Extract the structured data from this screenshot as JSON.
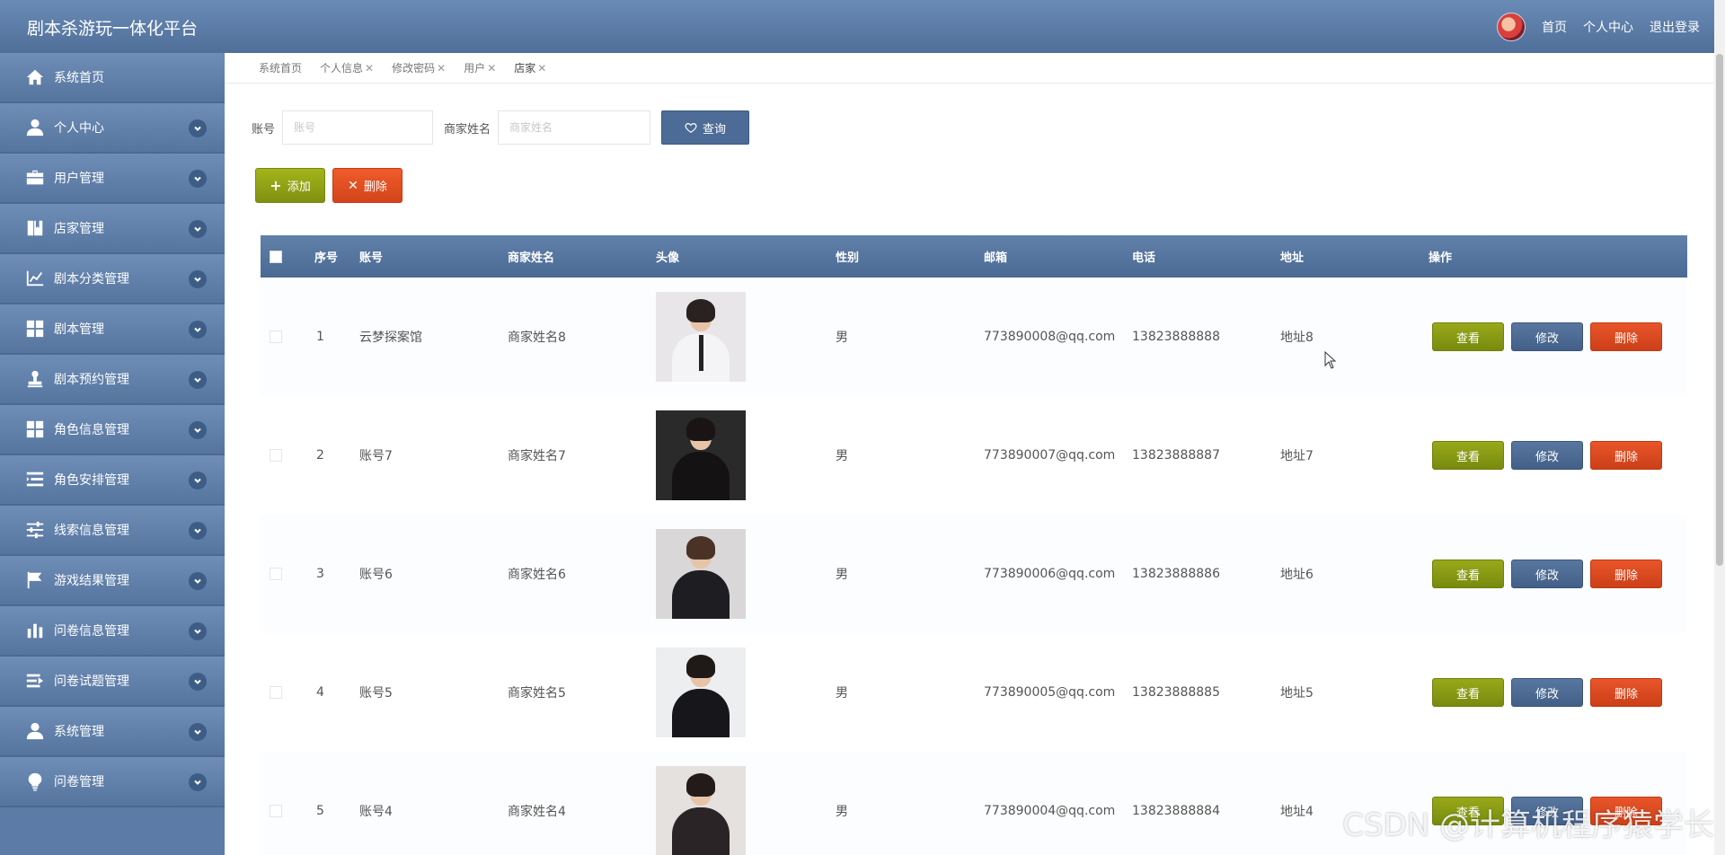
{
  "header": {
    "title": "剧本杀游玩一体化平台",
    "links": [
      "首页",
      "个人中心",
      "退出登录"
    ]
  },
  "sidebar": {
    "items": [
      {
        "label": "系统首页",
        "icon": "home-icon",
        "expandable": false
      },
      {
        "label": "个人中心",
        "icon": "user-icon",
        "expandable": true
      },
      {
        "label": "用户管理",
        "icon": "briefcase-icon",
        "expandable": true
      },
      {
        "label": "店家管理",
        "icon": "book-icon",
        "expandable": true
      },
      {
        "label": "剧本分类管理",
        "icon": "line-chart-icon",
        "expandable": true
      },
      {
        "label": "剧本管理",
        "icon": "grid-icon",
        "expandable": true
      },
      {
        "label": "剧本预约管理",
        "icon": "stamp-icon",
        "expandable": true
      },
      {
        "label": "角色信息管理",
        "icon": "grid-icon",
        "expandable": true
      },
      {
        "label": "角色安排管理",
        "icon": "list-indent-icon",
        "expandable": true
      },
      {
        "label": "线索信息管理",
        "icon": "sliders-icon",
        "expandable": true
      },
      {
        "label": "游戏结果管理",
        "icon": "flag-icon",
        "expandable": true
      },
      {
        "label": "问卷信息管理",
        "icon": "bar-chart-icon",
        "expandable": true
      },
      {
        "label": "问卷试题管理",
        "icon": "list-arrow-icon",
        "expandable": true
      },
      {
        "label": "系统管理",
        "icon": "user-icon",
        "expandable": true
      },
      {
        "label": "问卷管理",
        "icon": "bulb-icon",
        "expandable": true
      }
    ]
  },
  "tabs": [
    {
      "label": "系统首页",
      "closable": false
    },
    {
      "label": "个人信息",
      "closable": true
    },
    {
      "label": "修改密码",
      "closable": true
    },
    {
      "label": "用户",
      "closable": true
    },
    {
      "label": "店家",
      "closable": true,
      "active": true
    }
  ],
  "tab_close_glyph": "✕",
  "search": {
    "account_label": "账号",
    "account_placeholder": "账号",
    "merchant_label": "商家姓名",
    "merchant_placeholder": "商家姓名",
    "query_button": "查询"
  },
  "actions": {
    "add": "添加",
    "delete": "删除"
  },
  "table": {
    "headers": [
      "序号",
      "账号",
      "商家姓名",
      "头像",
      "性别",
      "邮箱",
      "电话",
      "地址",
      "操作"
    ],
    "ops": {
      "view": "查看",
      "edit": "修改",
      "delete": "删除"
    },
    "rows": [
      {
        "no": "1",
        "account": "云梦探案馆",
        "name": "商家姓名8",
        "gender": "男",
        "email": "773890008@qq.com",
        "phone": "13823888888",
        "address": "地址8"
      },
      {
        "no": "2",
        "account": "账号7",
        "name": "商家姓名7",
        "gender": "男",
        "email": "773890007@qq.com",
        "phone": "13823888887",
        "address": "地址7"
      },
      {
        "no": "3",
        "account": "账号6",
        "name": "商家姓名6",
        "gender": "男",
        "email": "773890006@qq.com",
        "phone": "13823888886",
        "address": "地址6"
      },
      {
        "no": "4",
        "account": "账号5",
        "name": "商家姓名5",
        "gender": "男",
        "email": "773890005@qq.com",
        "phone": "13823888885",
        "address": "地址5"
      },
      {
        "no": "5",
        "account": "账号4",
        "name": "商家姓名4",
        "gender": "男",
        "email": "773890004@qq.com",
        "phone": "13823888884",
        "address": "地址4"
      }
    ]
  },
  "watermark": "CSDN @计算机程序猿学长"
}
